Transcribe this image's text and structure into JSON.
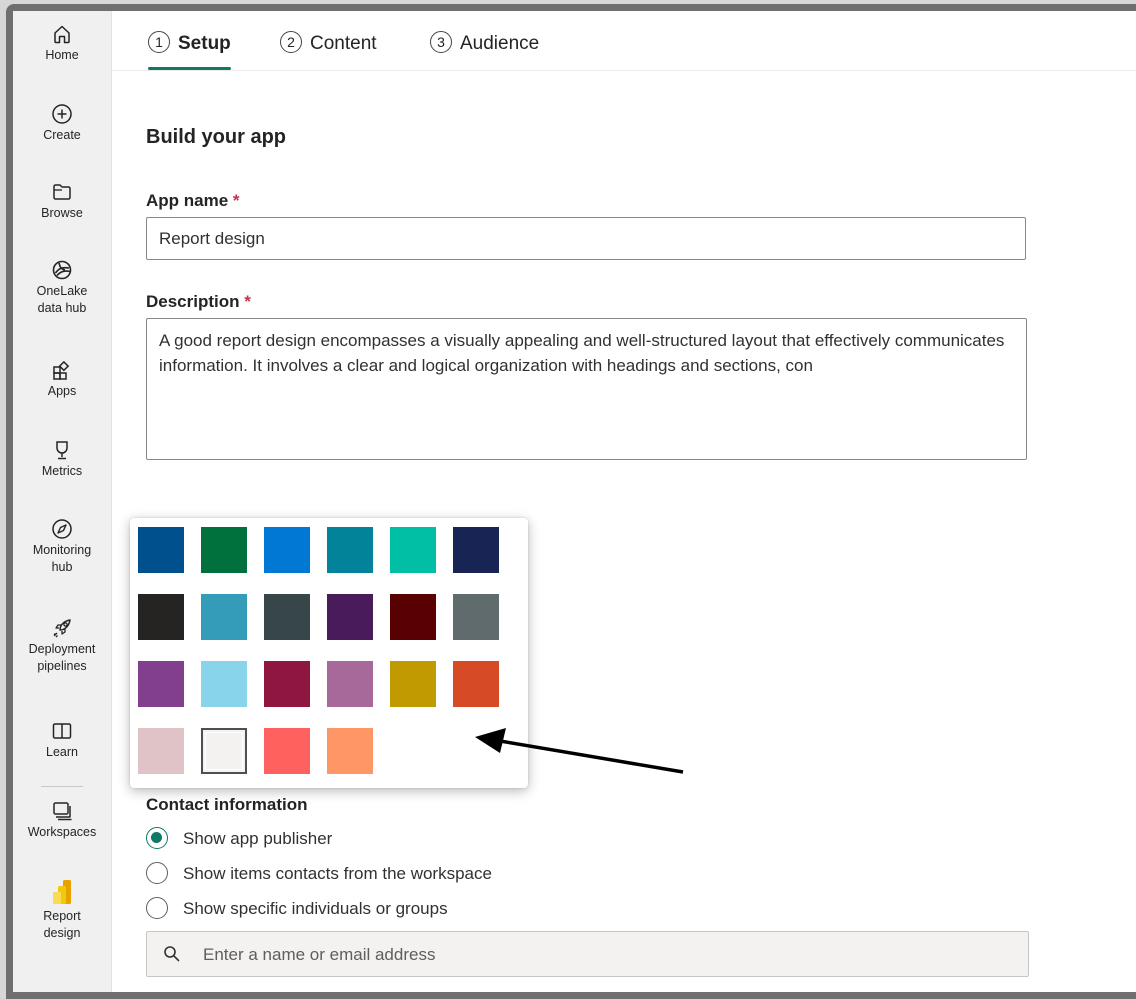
{
  "rail": {
    "items": [
      {
        "label": "Home",
        "icon": "home-icon"
      },
      {
        "label": "Create",
        "icon": "create-icon"
      },
      {
        "label": "Browse",
        "icon": "browse-icon"
      },
      {
        "label": "OneLake data hub",
        "icon": "onelake-icon"
      },
      {
        "label": "Apps",
        "icon": "apps-icon"
      },
      {
        "label": "Metrics",
        "icon": "metrics-icon"
      },
      {
        "label": "Monitoring hub",
        "icon": "monitoring-icon"
      },
      {
        "label": "Deployment pipelines",
        "icon": "deployment-icon"
      },
      {
        "label": "Learn",
        "icon": "learn-icon"
      },
      {
        "label": "Workspaces",
        "icon": "workspaces-icon"
      },
      {
        "label": "Report design",
        "icon": "report-design-icon"
      }
    ]
  },
  "tabs": [
    {
      "num": "1",
      "label": "Setup",
      "active": true
    },
    {
      "num": "2",
      "label": "Content",
      "active": false
    },
    {
      "num": "3",
      "label": "Audience",
      "active": false
    }
  ],
  "form": {
    "title": "Build your app",
    "app_name_label": "App name",
    "app_name_value": "Report design",
    "description_label": "Description",
    "description_value": "A good report design encompasses a visually appealing and well-structured layout that effectively communicates information. It involves a clear and logical organization with headings and sections, con",
    "required_mark": "*"
  },
  "palette": {
    "rows": [
      [
        "#00508e",
        "#00703c",
        "#0078d4",
        "#038399",
        "#00bfa5",
        "#182454"
      ],
      [
        "#252423",
        "#349bb9",
        "#374649",
        "#4a1b5a",
        "#590003",
        "#5f6b6d"
      ],
      [
        "#823f8e",
        "#88d4ea",
        "#8f1641",
        "#a66999",
        "#c09a00",
        "#d74a26"
      ],
      [
        "#dfc3c6",
        "#f3f2f1",
        "#fe615e",
        "#fe9666"
      ]
    ],
    "selected": "#f3f2f1"
  },
  "contact": {
    "title": "Contact information",
    "options": [
      {
        "label": "Show app publisher",
        "checked": true
      },
      {
        "label": "Show items contacts from the workspace",
        "checked": false
      },
      {
        "label": "Show specific individuals or groups",
        "checked": false
      }
    ],
    "search_placeholder": "Enter a name or email address"
  },
  "colors": {
    "accent": "#117865",
    "required": "#c4314b"
  }
}
